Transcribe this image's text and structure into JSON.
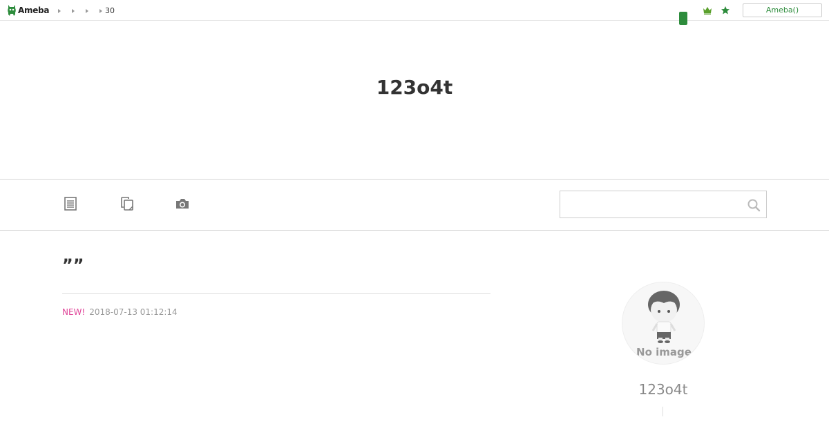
{
  "topbar": {
    "logo_text": "Ameba",
    "breadcrumbs": [
      {
        "label": ""
      },
      {
        "label": ""
      },
      {
        "label": ""
      },
      {
        "label": "30"
      }
    ],
    "ameba_button_label": "Ameba()",
    "icons": {
      "crown": "crown-icon",
      "star": "star-icon"
    },
    "accent_color": "#2d8c3c"
  },
  "blog": {
    "title": "123o4t"
  },
  "nav": {
    "items": [
      {
        "icon": "entry-list-icon"
      },
      {
        "icon": "pages-icon"
      },
      {
        "icon": "camera-icon"
      }
    ],
    "search": {
      "value": "",
      "placeholder": ""
    }
  },
  "entry": {
    "title": "””",
    "new_label": "NEW!",
    "timestamp": "2018-07-13 01:12:14",
    "new_color": "#e0489a"
  },
  "profile": {
    "avatar_text": "No image",
    "name": "123o4t"
  }
}
